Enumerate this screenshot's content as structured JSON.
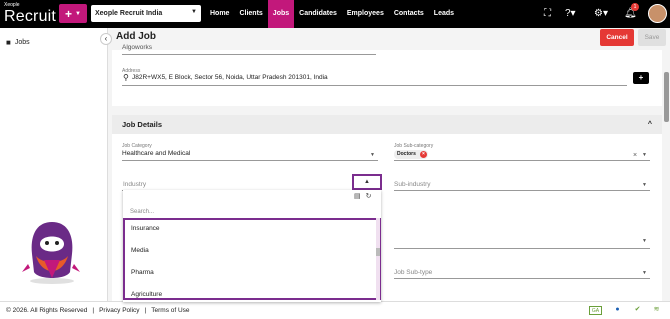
{
  "brand": {
    "small": "Xeople",
    "name": "Recruit"
  },
  "add_button": {
    "label": "+"
  },
  "company_select": {
    "value": "Xeople Recruit India"
  },
  "nav": [
    {
      "label": "Home",
      "active": false
    },
    {
      "label": "Clients",
      "active": false
    },
    {
      "label": "Jobs",
      "active": true
    },
    {
      "label": "Candidates",
      "active": false
    },
    {
      "label": "Employees",
      "active": false
    },
    {
      "label": "Contacts",
      "active": false
    },
    {
      "label": "Leads",
      "active": false
    }
  ],
  "notifications": {
    "count": "1"
  },
  "sidebar": {
    "items": [
      {
        "label": "Jobs",
        "icon": "briefcase-icon"
      }
    ]
  },
  "page": {
    "title": "Add Job",
    "cancel_label": "Cancel",
    "save_label": "Save"
  },
  "location": {
    "partial_value": "Algoworks",
    "address_label": "Address",
    "address_value": "J82R+WX5, E Block, Sector 56, Noida, Uttar Pradesh 201301, India"
  },
  "job_details": {
    "title": "Job Details",
    "category_label": "Job Category",
    "category_value": "Healthcare and Medical",
    "subcategory_label": "Job Sub-category",
    "subcategory_chip": "Doctors",
    "industry_placeholder": "Industry",
    "subindustry_placeholder": "Sub-industry",
    "job_subtype_placeholder": "Job Sub-type"
  },
  "industry_dropdown": {
    "search_placeholder": "Search...",
    "options": [
      "Insurance",
      "Media",
      "Pharma",
      "Agriculture"
    ]
  },
  "footer": {
    "copyright": "© 2026. All Rights Reserved",
    "separator": "|",
    "privacy": "Privacy Policy",
    "terms": "Terms of Use",
    "ga_badge": "GA"
  },
  "colors": {
    "accent": "#c2187b",
    "highlight": "#7b2d8e",
    "danger": "#e53935"
  }
}
